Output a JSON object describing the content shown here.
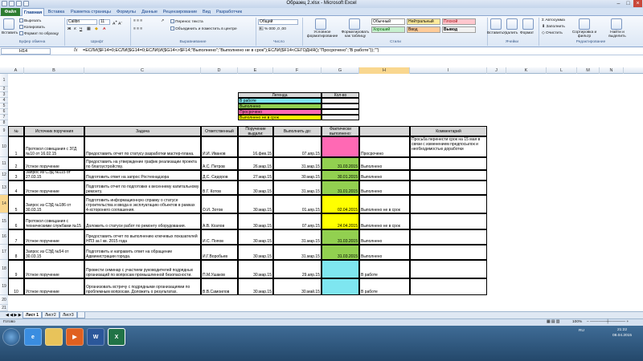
{
  "window": {
    "title": "Образец 2.xlsx - Microsoft Excel"
  },
  "tabs": [
    "Файл",
    "Главная",
    "Вставка",
    "Разметка страницы",
    "Формулы",
    "Данные",
    "Рецензирование",
    "Вид",
    "Разработчик"
  ],
  "ribbon": {
    "clipboard": {
      "paste": "Вставить",
      "cut": "Вырезать",
      "copy": "Копировать",
      "format_painter": "Формат по образцу",
      "label": "Буфер обмена"
    },
    "font": {
      "name": "Calibri",
      "size": "11",
      "label": "Шрифт"
    },
    "alignment": {
      "wrap": "Перенос текста",
      "merge": "Объединить и поместить в центре",
      "label": "Выравнивание"
    },
    "number": {
      "format": "Общий",
      "label": "Число"
    },
    "styles": {
      "conditional": "Условное форматирование",
      "as_table": "Форматировать как таблицу",
      "normal": "Обычный",
      "neutral": "Нейтральный",
      "bad": "Плохой",
      "good": "Хороший",
      "input": "Ввод",
      "output": "Вывод",
      "label": "Стили"
    },
    "cells": {
      "insert": "Вставить",
      "delete": "Удалить",
      "format": "Формат",
      "label": "Ячейки"
    },
    "editing": {
      "autosum": "Автосумма",
      "fill": "Заполнить",
      "clear": "Очистить",
      "sort": "Сортировка и фильтр",
      "find": "Найти и выделить",
      "label": "Редактирование"
    }
  },
  "formula_bar": {
    "name_box": "H14",
    "fx": "fx",
    "formula": "=ЕСЛИ($F14=0;ЕСЛИ($G14=0;ЕСЛИ(И($G14<>$F14;\"Выполнено\";\"Выполнено не в срок\");ЕСЛИ($F14<СЕГОДНЯ();\"Просрочено\";\"В работе\"));\"\")"
  },
  "columns": [
    "A",
    "B",
    "C",
    "D",
    "E",
    "F",
    "G",
    "H",
    "I",
    "J",
    "K",
    "L",
    "M",
    "N"
  ],
  "rows": [
    "1",
    "2",
    "3",
    "4",
    "5",
    "6",
    "7",
    "8",
    "9",
    "10",
    "11",
    "12",
    "13",
    "14",
    "15",
    "16",
    "17",
    "18",
    "19",
    "20",
    "21",
    "22",
    "23"
  ],
  "legend": {
    "title": "Легенда",
    "count_header": "Кол-во",
    "items": [
      {
        "label": "В работе",
        "color": "#7ee6f0"
      },
      {
        "label": "Выполнено",
        "color": "#92d050"
      },
      {
        "label": "Просрочено",
        "color": "#ff69b4"
      },
      {
        "label": "Выполнено не в срок",
        "color": "#ffff00"
      }
    ]
  },
  "table": {
    "headers": [
      "№",
      "Источник поручения",
      "Задача",
      "Ответственный",
      "Поручение выдали:",
      "Выполнить до:",
      "Фактически выполнено:",
      "",
      "Комментарий"
    ],
    "rows": [
      {
        "n": "1",
        "source": "Протокол совещания с ЗГД №10 от 16.02.15",
        "task": "Предоставить отчет по статусу разработки мастер-плана.",
        "owner": "И.И. Иванов",
        "issued": "16.фев.15",
        "due": "07.апр.15",
        "done": "",
        "status": "Просрочено",
        "comment": "Просьба перенести срок на 15 мая в связи с изменением предпосылок и необходимостью доработки",
        "color": "#ff69b4"
      },
      {
        "n": "2",
        "source": "Устное поручение",
        "task": "Предоставить на утверждение график реализации проекта по благоустройству.",
        "owner": "А.С. Петров",
        "issued": "26.мар.15",
        "due": "31.мар.15",
        "done": "31.03.2015",
        "status": "Выполнено",
        "comment": "",
        "color": "#92d050"
      },
      {
        "n": "3",
        "source": "Запрос из СЭД №115 от 27.03.15",
        "task": "Подготовить ответ на запрос Ростехнадзора",
        "owner": "Д.С. Сидоров",
        "issued": "27.мар.15",
        "due": "30.мар.15",
        "done": "30.01.2015",
        "status": "Выполнено",
        "comment": "",
        "color": "#92d050"
      },
      {
        "n": "4",
        "source": "Устное поручение",
        "task": "Подготовить отчет по подготовке к весеннему капитальному ремонту.",
        "owner": "В.Г. Котов",
        "issued": "30.мар.15",
        "due": "31.мар.15",
        "done": "31.01.2015",
        "status": "Выполнено",
        "comment": "",
        "color": "#92d050"
      },
      {
        "n": "5",
        "source": "Запрос из СЭД №186 от 30.03.15",
        "task": "Подготовить информационную справку о статусе строительства и ввода в эксплуатацию объектов в рамках 4-хсторонего соглашения.",
        "owner": "О.И. Зотов",
        "issued": "30.мар.15",
        "due": "01.апр.15",
        "done": "02.04.2015",
        "status": "Выполнено не в срок",
        "comment": "",
        "color": "#ffff00"
      },
      {
        "n": "6",
        "source": "Протокол совещания с техническими службами №15",
        "task": "Доложить о статусе работ по ремонту оборудования.",
        "owner": "А.В. Козлов",
        "issued": "30.мар.15",
        "due": "07.апр.15",
        "done": "24.04.2015",
        "status": "Выполнено не в срок",
        "comment": "",
        "color": "#ffff00"
      },
      {
        "n": "7",
        "source": "Устное поручение",
        "task": "Предоставить отчет по выполнению ключевых показателей НПЗ за I кв. 2015 года",
        "owner": "И.С. Попов",
        "issued": "30.мар.15",
        "due": "31.мар.15",
        "done": "31.03.2015",
        "status": "Выполнено",
        "comment": "",
        "color": "#92d050"
      },
      {
        "n": "8",
        "source": "Запрос из СЭД №54 от 30.03.15",
        "task": "Подготовить и направить ответ на обращение Администрации города.",
        "owner": "И.Г.Воробьев",
        "issued": "30.мар.15",
        "due": "31.мар.15",
        "done": "31.03.2015",
        "status": "Выполнено",
        "comment": "",
        "color": "#92d050"
      },
      {
        "n": "9",
        "source": "Устное поручение",
        "task": "Провести семинар с участием руководителей подрядных организаций по вопросам промышленной безопасности.",
        "owner": "П.М.Ушаков",
        "issued": "30.мар.15",
        "due": "29.апр.15",
        "done": "",
        "status": "В работе",
        "comment": "",
        "color": "#7ee6f0"
      },
      {
        "n": "10",
        "source": "Устное поручение",
        "task": "Организовать встречу с подрядными организациями по проблемным вопросам. Доложить о результатах.",
        "owner": "В.В.Самоилов",
        "issued": "30.мар.15",
        "due": "30.май.15",
        "done": "",
        "status": "В работе",
        "comment": "",
        "color": "#7ee6f0"
      }
    ]
  },
  "sheets": [
    "Лист 1",
    "Лист2",
    "Лист3"
  ],
  "status": {
    "ready": "Готово",
    "zoom": "100%"
  },
  "taskbar": {
    "time": "21:22",
    "date": "08.04.2015",
    "lang": "RU"
  }
}
